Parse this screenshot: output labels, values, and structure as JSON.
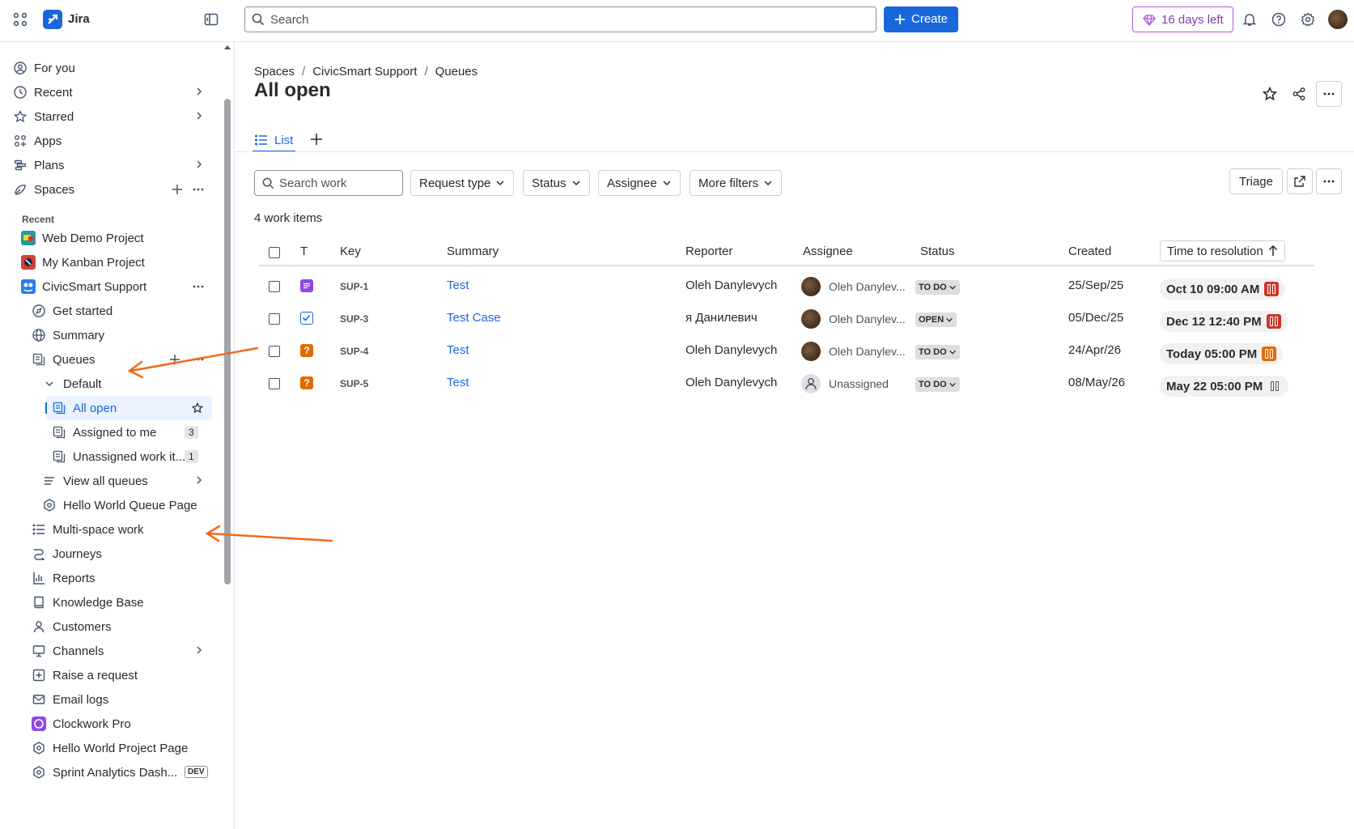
{
  "topbar": {
    "app_name": "Jira",
    "search_placeholder": "Search",
    "create_label": "Create",
    "trial_label": "16 days left"
  },
  "sidebar": {
    "for_you": "For you",
    "recent": "Recent",
    "starred": "Starred",
    "apps": "Apps",
    "plans": "Plans",
    "spaces": "Spaces",
    "recent_header": "Recent",
    "projects": [
      "Web Demo Project",
      "My Kanban Project",
      "CivicSmart Support"
    ],
    "get_started": "Get started",
    "summary": "Summary",
    "queues": "Queues",
    "default": "Default",
    "all_open": "All open",
    "assigned_to_me": "Assigned to me",
    "assigned_to_me_count": "3",
    "unassigned": "Unassigned work it...",
    "unassigned_count": "1",
    "view_all_queues": "View all queues",
    "hello_world_queue": "Hello World Queue Page",
    "multi_space": "Multi-space work",
    "journeys": "Journeys",
    "reports": "Reports",
    "knowledge_base": "Knowledge Base",
    "customers": "Customers",
    "channels": "Channels",
    "raise_request": "Raise a request",
    "email_logs": "Email logs",
    "clockwork": "Clockwork Pro",
    "hello_world_project": "Hello World Project Page",
    "sprint_analytics": "Sprint Analytics Dash...",
    "dev_badge": "DEV"
  },
  "breadcrumb": [
    "Spaces",
    "CivicSmart Support",
    "Queues"
  ],
  "page_title": "All open",
  "tabs": {
    "list": "List"
  },
  "filters": {
    "search_placeholder": "Search work",
    "request_type": "Request type",
    "status": "Status",
    "assignee": "Assignee",
    "more": "More filters",
    "triage": "Triage"
  },
  "count_label": "4 work items",
  "columns": [
    "T",
    "Key",
    "Summary",
    "Reporter",
    "Assignee",
    "Status",
    "Created",
    "Time to resolution"
  ],
  "rows": [
    {
      "type": "task-icon",
      "key": "SUP-1",
      "summary": "Test",
      "reporter": "Oleh Danylevych",
      "assignee": "Oleh Danylev...",
      "status": "TO DO",
      "created": "25/Sep/25",
      "ttr": "Oct 10 09:00 AM",
      "ttr_color": "#c9372c"
    },
    {
      "type": "test-case-icon",
      "key": "SUP-3",
      "summary": "Test Case",
      "reporter": "я Данилевич",
      "assignee": "Oleh Danylev...",
      "status": "OPEN",
      "created": "05/Dec/25",
      "ttr": "Dec 12 12:40 PM",
      "ttr_color": "#c9372c"
    },
    {
      "type": "question-icon",
      "key": "SUP-4",
      "summary": "Test",
      "reporter": "Oleh Danylevych",
      "assignee": "Oleh Danylev...",
      "status": "TO DO",
      "created": "24/Apr/26",
      "ttr": "Today 05:00 PM",
      "ttr_color": "#e06c00"
    },
    {
      "type": "question-icon",
      "key": "SUP-5",
      "summary": "Test",
      "reporter": "Oleh Danylevych",
      "assignee": "Unassigned",
      "status": "TO DO",
      "created": "08/May/26",
      "ttr": "May 22 05:00 PM",
      "ttr_color": "#505258"
    }
  ]
}
